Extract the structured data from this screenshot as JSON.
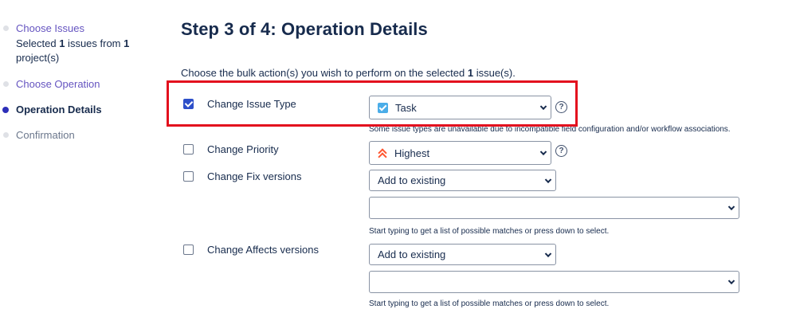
{
  "sidebar": {
    "steps": [
      {
        "label": "Choose Issues",
        "state": "completed",
        "sub_prefix": "Selected ",
        "sub_count": "1",
        "sub_middle": " issues from ",
        "sub_projects": "1",
        "sub_suffix": "project(s)"
      },
      {
        "label": "Choose Operation",
        "state": "completed"
      },
      {
        "label": "Operation Details",
        "state": "current"
      },
      {
        "label": "Confirmation",
        "state": "pending"
      }
    ]
  },
  "main": {
    "title": "Step 3 of 4: Operation Details",
    "intro_prefix": "Choose the bulk action(s) you wish to perform on the selected ",
    "intro_count": "1",
    "intro_suffix": " issue(s).",
    "rows": {
      "issue_type": {
        "label": "Change Issue Type",
        "checked": true,
        "value": "Task",
        "icon": "task-icon",
        "help": "?",
        "hint": "Some issue types are unavailable due to incompatible field configuration and/or workflow associations."
      },
      "priority": {
        "label": "Change Priority",
        "checked": false,
        "value": "Highest",
        "icon": "priority-highest-icon",
        "help": "?"
      },
      "fix_versions": {
        "label": "Change Fix versions",
        "checked": false,
        "mode": "Add to existing",
        "versions_value": "",
        "hint": "Start typing to get a list of possible matches or press down to select."
      },
      "affects_versions": {
        "label": "Change Affects versions",
        "checked": false,
        "mode": "Add to existing",
        "versions_value": "",
        "hint": "Start typing to get a list of possible matches or press down to select."
      }
    }
  },
  "colors": {
    "accent": "#2d4fc9",
    "link": "#6554c0",
    "highlight": "#e3101e",
    "task": "#4bade8",
    "priority": "#ff5630"
  }
}
